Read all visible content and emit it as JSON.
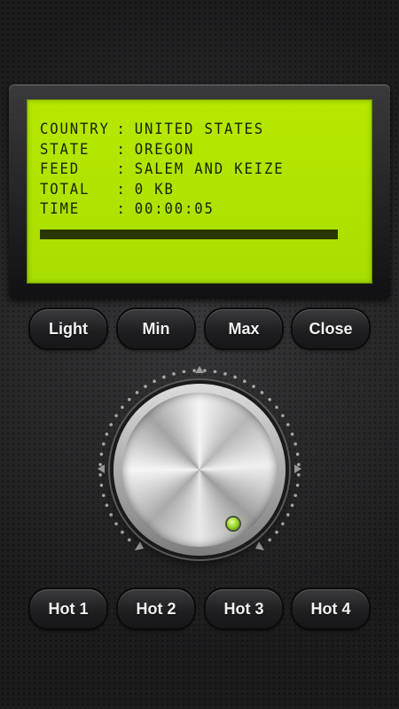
{
  "lcd": {
    "rows": [
      {
        "label": "COUNTRY",
        "sep": ":",
        "value": "UNITED STATES"
      },
      {
        "label": "STATE",
        "sep": ":",
        "value": "OREGON"
      },
      {
        "label": "FEED",
        "sep": ":",
        "value": "SALEM AND KEIZE"
      },
      {
        "label": "TOTAL",
        "sep": ":",
        "value": "0 KB"
      },
      {
        "label": "TIME",
        "sep": ":",
        "value": "00:00:05"
      }
    ],
    "progress": 1.0,
    "color": "#b6e800",
    "text_color": "#1a2400"
  },
  "controls": {
    "light": "Light",
    "min": "Min",
    "max": "Max",
    "close": "Close"
  },
  "presets": {
    "hot1": "Hot 1",
    "hot2": "Hot 2",
    "hot3": "Hot 3",
    "hot4": "Hot 4"
  },
  "knob": {
    "indicator_color": "#8dd11c",
    "icon": "volume-knob-icon"
  }
}
